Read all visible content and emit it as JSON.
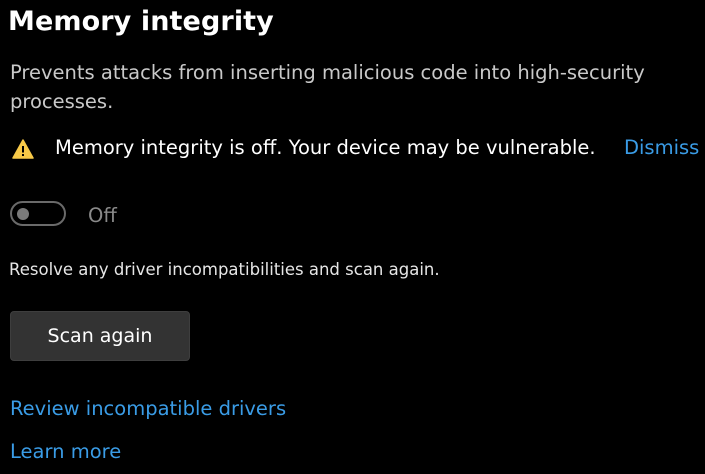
{
  "page": {
    "title": "Memory integrity",
    "description": "Prevents attacks from inserting malicious code into high-security processes."
  },
  "warning": {
    "icon": "warning-icon",
    "message": "Memory integrity is off. Your device may be vulnerable.",
    "dismiss_label": "Dismiss"
  },
  "toggle": {
    "state_label": "Off",
    "on": false
  },
  "resolve_text": "Resolve any driver incompatibilities and scan again.",
  "scan_button_label": "Scan again",
  "links": {
    "review_drivers": "Review incompatible drivers",
    "learn_more": "Learn more"
  },
  "colors": {
    "background": "#000000",
    "link": "#3a9ce6",
    "warning_icon": "#f7c948",
    "button_bg": "#333333"
  }
}
